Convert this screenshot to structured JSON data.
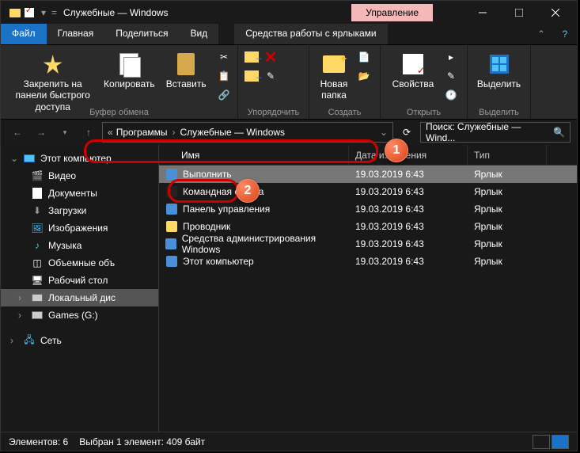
{
  "titlebar": {
    "title": "Служебные — Windows",
    "mgmt_tab": "Управление"
  },
  "tabs": {
    "file": "Файл",
    "home": "Главная",
    "share": "Поделиться",
    "view": "Вид",
    "shortcut_tools": "Средства работы с ярлыками"
  },
  "ribbon": {
    "pin": "Закрепить на панели быстрого доступа",
    "copy": "Копировать",
    "paste": "Вставить",
    "clipboard_group": "Буфер обмена",
    "organize_group": "Упорядочить",
    "new_folder": "Новая\nпапка",
    "new_group": "Создать",
    "properties": "Свойства",
    "open_group": "Открыть",
    "select": "Выделить",
    "select_group": "Выделить"
  },
  "address": {
    "seg1": "Программы",
    "seg2": "Служебные — Windows"
  },
  "search": {
    "placeholder": "Поиск: Служебные — Wind..."
  },
  "sidebar": {
    "this_pc": "Этот компьютер",
    "videos": "Видео",
    "documents": "Документы",
    "downloads": "Загрузки",
    "pictures": "Изображения",
    "music": "Музыка",
    "volumes": "Объемные объ",
    "desktop": "Рабочий стол",
    "local_disk": "Локальный дис",
    "games": "Games (G:)",
    "network": "Сеть"
  },
  "columns": {
    "name": "Имя",
    "date": "Дата изменения",
    "type": "Тип"
  },
  "files": [
    {
      "name": "Выполнить",
      "date": "19.03.2019 6:43",
      "type": "Ярлык"
    },
    {
      "name": "Командная строка",
      "date": "19.03.2019 6:43",
      "type": "Ярлык"
    },
    {
      "name": "Панель управления",
      "date": "19.03.2019 6:43",
      "type": "Ярлык"
    },
    {
      "name": "Проводник",
      "date": "19.03.2019 6:43",
      "type": "Ярлык"
    },
    {
      "name": "Средства администрирования Windows",
      "date": "19.03.2019 6:43",
      "type": "Ярлык"
    },
    {
      "name": "Этот компьютер",
      "date": "19.03.2019 6:43",
      "type": "Ярлык"
    }
  ],
  "status": {
    "elements": "Элементов: 6",
    "selected": "Выбран 1 элемент: 409 байт"
  },
  "markers": {
    "m1": "1",
    "m2": "2"
  }
}
